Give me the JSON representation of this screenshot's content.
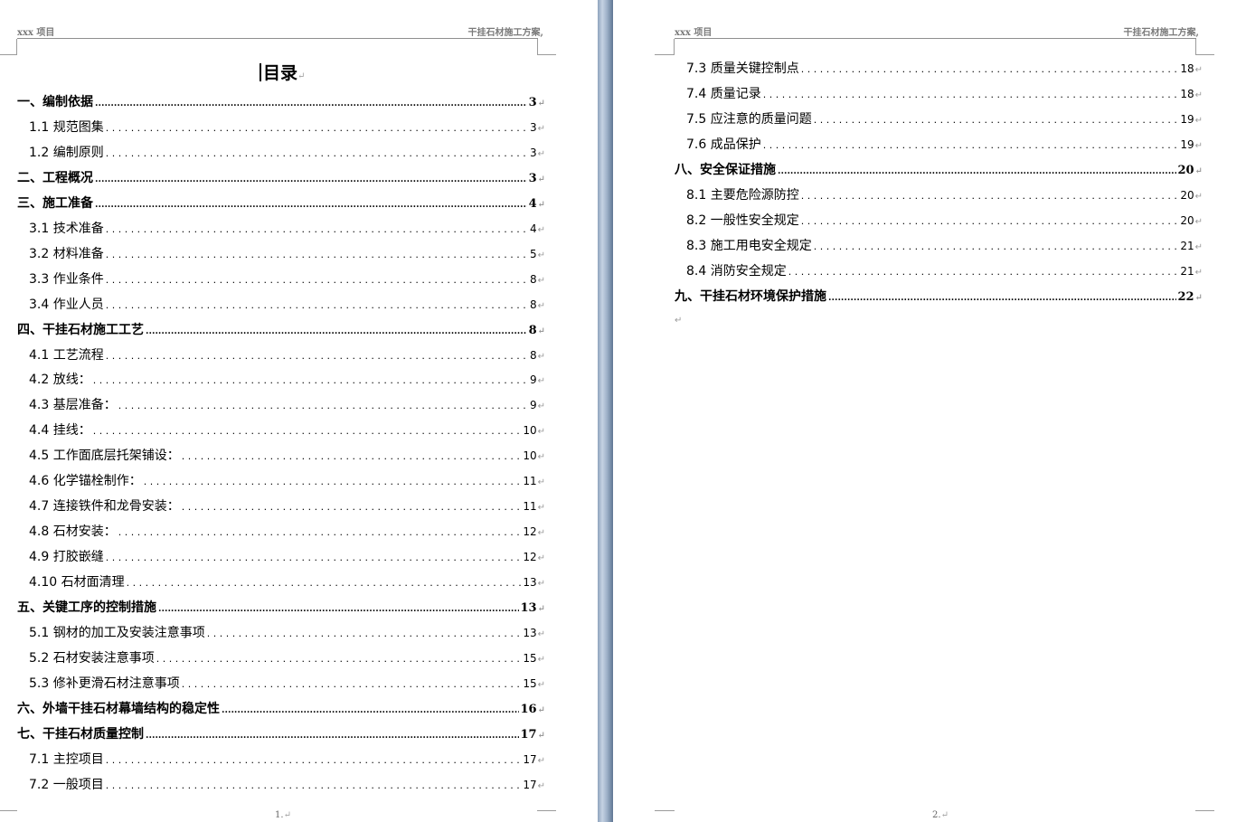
{
  "header": {
    "left": "xxx 项目",
    "right": "干挂石材施工方案"
  },
  "page1": {
    "title": "目录",
    "footer": "1",
    "entries": [
      {
        "level": 1,
        "text": "一、编制依据",
        "page": "3"
      },
      {
        "level": 2,
        "text": "1.1 规范图集",
        "page": "3"
      },
      {
        "level": 2,
        "text": "1.2 编制原则",
        "page": "3"
      },
      {
        "level": 1,
        "text": "二、工程概况",
        "page": "3"
      },
      {
        "level": 1,
        "text": "三、施工准备",
        "page": "4"
      },
      {
        "level": 2,
        "text": "3.1 技术准备",
        "page": "4"
      },
      {
        "level": 2,
        "text": "3.2 材料准备",
        "page": "5"
      },
      {
        "level": 2,
        "text": "3.3 作业条件",
        "page": "8"
      },
      {
        "level": 2,
        "text": "3.4   作业人员",
        "page": "8"
      },
      {
        "level": 1,
        "text": "四、干挂石材施工工艺",
        "page": "8"
      },
      {
        "level": 2,
        "text": "4.1 工艺流程",
        "page": "8"
      },
      {
        "level": 2,
        "text": "4.2 放线：",
        "page": "9"
      },
      {
        "level": 2,
        "text": "4.3 基层准备：",
        "page": "9"
      },
      {
        "level": 2,
        "text": "4.4 挂线：",
        "page": "10"
      },
      {
        "level": 2,
        "text": "4.5 工作面底层托架铺设：",
        "page": "10"
      },
      {
        "level": 2,
        "text": "4.6 化学锚栓制作：",
        "page": "11"
      },
      {
        "level": 2,
        "text": "4.7 连接铁件和龙骨安装：",
        "page": "11"
      },
      {
        "level": 2,
        "text": "4.8 石材安装：",
        "page": "12"
      },
      {
        "level": 2,
        "text": "4.9 打胶嵌缝",
        "page": "12"
      },
      {
        "level": 2,
        "text": "4.10 石材面清理",
        "page": "13"
      },
      {
        "level": 1,
        "text": "五、关键工序的控制措施",
        "page": "13"
      },
      {
        "level": 2,
        "text": "5.1 钢材的加工及安装注意事项",
        "page": "13"
      },
      {
        "level": 2,
        "text": "5.2 石材安装注意事项",
        "page": "15"
      },
      {
        "level": 2,
        "text": "5.3 修补更滑石材注意事项",
        "page": "15"
      },
      {
        "level": 1,
        "text": "六、外墙干挂石材幕墙结构的稳定性",
        "page": "16"
      },
      {
        "level": 1,
        "text": "七、干挂石材质量控制",
        "page": "17"
      },
      {
        "level": 2,
        "text": "7.1 主控项目",
        "page": "17"
      },
      {
        "level": 2,
        "text": "7.2 一般项目",
        "page": "17"
      }
    ]
  },
  "page2": {
    "footer": "2",
    "entries": [
      {
        "level": 2,
        "text": "7.3 质量关键控制点",
        "page": "18"
      },
      {
        "level": 2,
        "text": "7.4   质量记录",
        "page": "18"
      },
      {
        "level": 2,
        "text": "7.5   应注意的质量问题",
        "page": "19"
      },
      {
        "level": 2,
        "text": "7.6 成品保护",
        "page": "19"
      },
      {
        "level": 1,
        "text": "八、安全保证措施",
        "page": "20"
      },
      {
        "level": 2,
        "text": "8.1 主要危险源防控",
        "page": "20"
      },
      {
        "level": 2,
        "text": "8.2 一般性安全规定",
        "page": "20"
      },
      {
        "level": 2,
        "text": "8.3 施工用电安全规定",
        "page": "21"
      },
      {
        "level": 2,
        "text": "8.4 消防安全规定",
        "page": "21"
      },
      {
        "level": 1,
        "text": "九、干挂石材环境保护措施",
        "page": "22"
      }
    ]
  },
  "symbols": {
    "return_mark": "↵",
    "footer_suffix": ".",
    "header_suffix": ","
  }
}
